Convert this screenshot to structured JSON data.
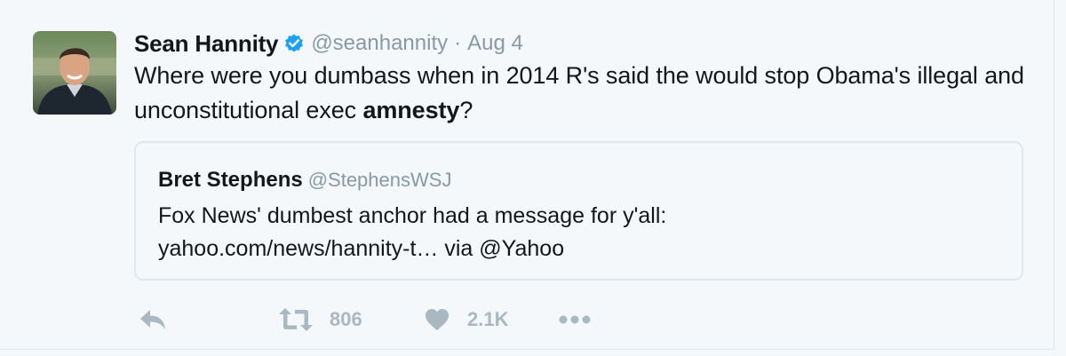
{
  "tweet": {
    "author_name": "Sean Hannity",
    "author_handle": "@seanhannity",
    "separator": "·",
    "date": "Aug 4",
    "text_part1": "Where were you dumbass when in 2014 R's said the would stop Obama's illegal and unconstitutional exec ",
    "text_bold": "amnesty",
    "text_part2": "?"
  },
  "quoted_tweet": {
    "author_name": "Bret Stephens",
    "author_handle": "@StephensWSJ",
    "text_line1": "Fox News' dumbest anchor had a message for y'all:",
    "text_line2": "yahoo.com/news/hannity-t… via @Yahoo"
  },
  "actions": {
    "reply_icon": "reply-icon",
    "retweet_icon": "retweet-icon",
    "retweet_count": "806",
    "like_icon": "heart-icon",
    "like_count": "2.1K",
    "more_icon": "more-icon"
  },
  "colors": {
    "background": "#f5f8fa",
    "text": "#14171a",
    "muted": "#8899a6",
    "action_gray": "#aab8c2",
    "verified_blue": "#1da1f2",
    "border": "#e1e8ed"
  }
}
